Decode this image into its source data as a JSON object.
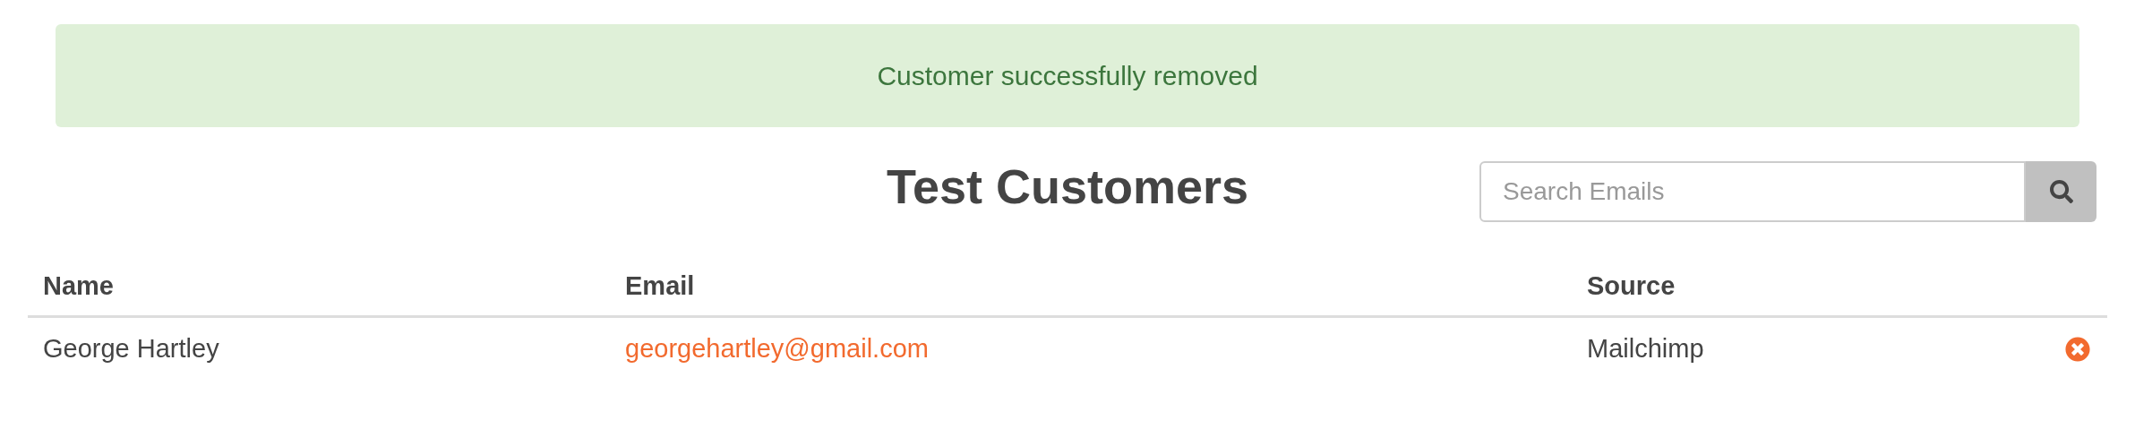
{
  "alert": {
    "message": "Customer successfully removed"
  },
  "title": "Test Customers",
  "search": {
    "placeholder": "Search Emails"
  },
  "table": {
    "columns": [
      "Name",
      "Email",
      "Source"
    ],
    "rows": [
      {
        "name": "George Hartley",
        "email": "georgehartley@gmail.com",
        "source": "Mailchimp"
      }
    ]
  }
}
